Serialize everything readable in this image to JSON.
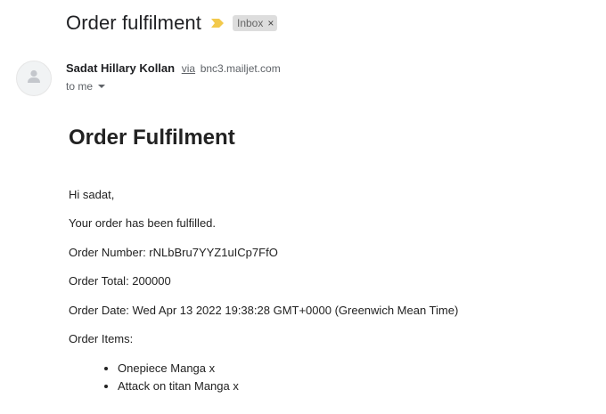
{
  "email": {
    "subject": "Order fulfilment",
    "label": "Inbox",
    "label_close": "×",
    "sender_name": "Sadat Hillary Kollan",
    "via_label": "via",
    "via_domain": "bnc3.mailjet.com",
    "to_label": "to me"
  },
  "message": {
    "heading": "Order Fulfilment",
    "greeting": "Hi sadat,",
    "status_line": "Your order has been fulfilled.",
    "order_number": "Order Number: rNLbBru7YYZ1uICp7FfO",
    "order_total": "Order Total: 200000",
    "order_date": "Order Date: Wed Apr 13 2022 19:38:28 GMT+0000 (Greenwich Mean Time)",
    "items_label": "Order Items:",
    "items": [
      "Onepiece Manga x",
      "Attack on titan Manga x"
    ]
  },
  "colors": {
    "importance_marker": "#f2c94c",
    "label_chip_bg": "#dddddd"
  },
  "icons": {
    "avatar": "person-icon",
    "importance": "importance-marker-icon",
    "to_me_caret": "caret-down-icon"
  }
}
